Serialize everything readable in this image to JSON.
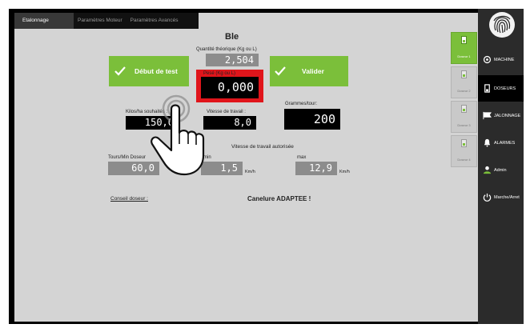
{
  "tabs": [
    {
      "label": "Etalonnage",
      "active": true
    },
    {
      "label": "Paramètres Moteur",
      "active": false
    },
    {
      "label": "Paramètres Avancés",
      "active": false
    }
  ],
  "product_title": "Ble",
  "theoretical_qty": {
    "label": "Quantité théorique (Kg ou L)",
    "value": "2,504"
  },
  "weighed_qty": {
    "label": "Pesé (Kg ou L)",
    "value": "0,000"
  },
  "buttons": {
    "start_test": "Début de test",
    "validate": "Valider"
  },
  "kilos_ha": {
    "label": "Kilos/ha souhaités :",
    "value": "150,0"
  },
  "work_speed": {
    "label": "Vitesse de travail :",
    "value": "8,0"
  },
  "grams_per_turn": {
    "label": "Grammes/tour:",
    "value": "200"
  },
  "authorized_speed": {
    "title": "Vitesse de travail autorisée",
    "min_label": "min",
    "min_value": "1,5",
    "max_label": "max",
    "max_value": "12,9",
    "unit": "Km/h"
  },
  "turns_per_min": {
    "label": "Tours/Min Doseur",
    "value": "60,0"
  },
  "advice": {
    "label": "Conseil doseur :",
    "message": "Canelure ADAPTEE !"
  },
  "doseurs": [
    {
      "label": "Doseur 1",
      "active": true
    },
    {
      "label": "Doseur 2",
      "active": false
    },
    {
      "label": "Doseur 3",
      "active": false
    },
    {
      "label": "Doseur 4",
      "active": false
    }
  ],
  "sidebar": [
    {
      "label": "MACHINE",
      "icon": "gear-icon"
    },
    {
      "label": "DOSEURS",
      "icon": "hopper-icon",
      "active": true
    },
    {
      "label": "JALONNAGE",
      "icon": "flag-icon"
    },
    {
      "label": "ALARMES",
      "icon": "bell-icon"
    },
    {
      "label": "Admin",
      "icon": "user-icon"
    },
    {
      "label": "Marche/Arret",
      "icon": "power-icon"
    }
  ],
  "colors": {
    "accent_green": "#7bbf3a",
    "highlight_red": "#e0151b",
    "sidebar_bg": "#2b2b2b"
  }
}
